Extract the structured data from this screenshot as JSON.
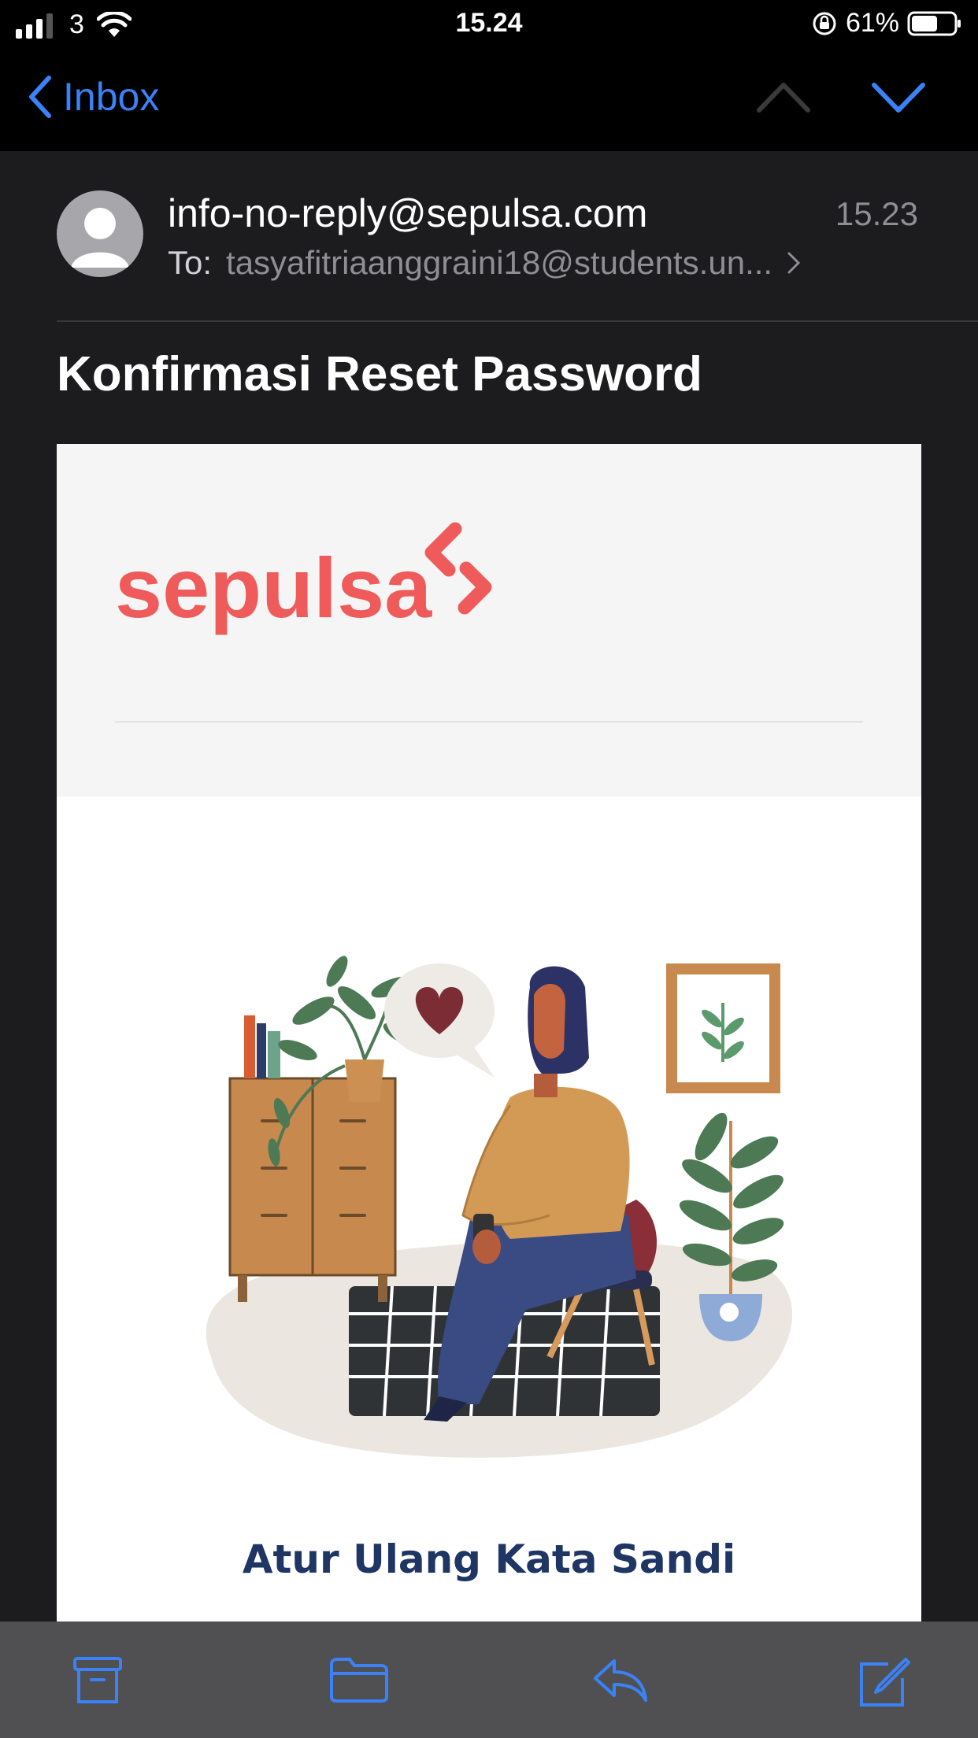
{
  "status_bar": {
    "carrier": "3",
    "time": "15.24",
    "battery": "61%",
    "battery_level": 0.61
  },
  "nav": {
    "back_label": "Inbox",
    "icons": [
      "chevron-left-icon",
      "chevron-up-icon",
      "chevron-down-icon"
    ]
  },
  "email": {
    "sender": "info-no-reply@sepulsa.com",
    "time": "15.23",
    "to_label": "To:",
    "to_address": "tasyafitriaanggraini18@students.un...",
    "subject": "Konfirmasi Reset Password"
  },
  "content": {
    "brand": "sepulsa",
    "heading": "Atur Ulang Kata Sandi"
  },
  "toolbar": {
    "icons": [
      "archive-icon",
      "folder-icon",
      "reply-icon",
      "compose-icon"
    ]
  },
  "colors": {
    "accent": "#3b82f6",
    "brand": "#ef5b5b",
    "heading": "#1f3563"
  }
}
